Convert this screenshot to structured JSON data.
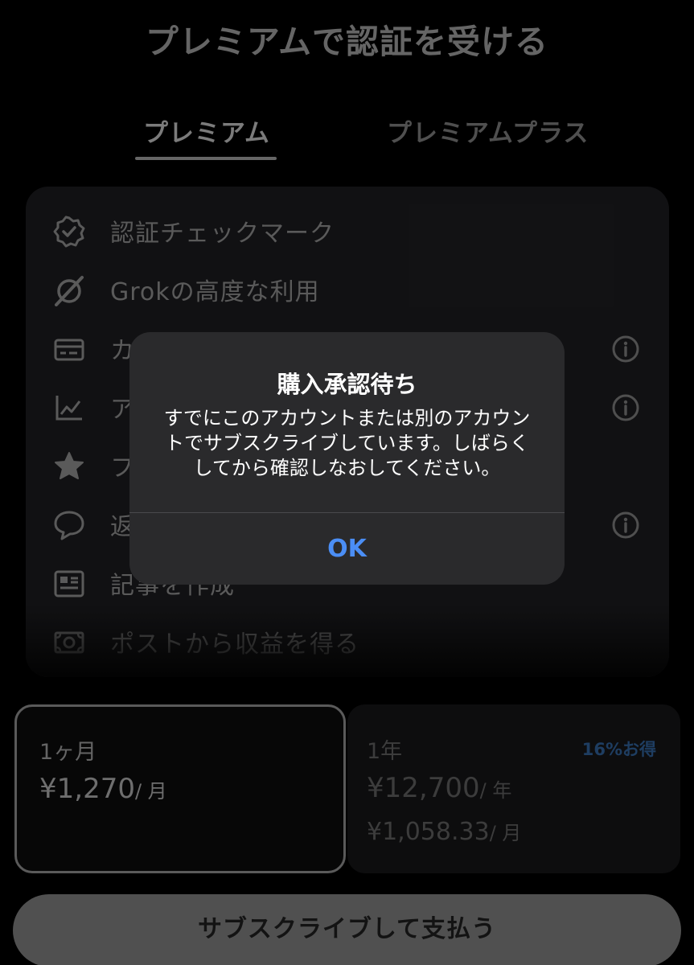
{
  "page_title": "プレミアムで認証を受ける",
  "tabs": [
    {
      "label": "プレミアム",
      "active": true
    },
    {
      "label": "プレミアムプラス",
      "active": false
    }
  ],
  "features": [
    {
      "label": "認証チェックマーク",
      "icon": "verified-badge-icon",
      "info": false
    },
    {
      "label": "Grokの高度な利用",
      "icon": "grok-icon",
      "info": false
    },
    {
      "label": "カ",
      "icon": "card-icon",
      "info": true
    },
    {
      "label": "ア",
      "icon": "analytics-icon",
      "info": true
    },
    {
      "label": "フ",
      "icon": "star-icon",
      "info": false
    },
    {
      "label": "返",
      "icon": "reply-bubble-icon",
      "info": true
    },
    {
      "label": "記事を作成",
      "icon": "article-icon",
      "info": false
    },
    {
      "label": "ポストから収益を得る",
      "icon": "money-icon",
      "info": false
    }
  ],
  "alert": {
    "title": "購入承認待ち",
    "message_lines": [
      "すでにこのアカウントまたは別のアカウン",
      "トでサブスクライブしています。しばらく",
      "してから確認しなおしてください。"
    ],
    "ok_label": "OK"
  },
  "plans": {
    "monthly": {
      "name": "1ヶ月",
      "price": "¥1,270",
      "unit": "/ 月",
      "selected": true
    },
    "yearly": {
      "name": "1年",
      "price": "¥12,700",
      "unit": "/ 年",
      "monthly_price": "¥1,058.33",
      "monthly_unit": "/ 月",
      "badge": "16%お得",
      "selected": false
    }
  },
  "subscribe_label": "サブスクライブして支払う",
  "colors": {
    "accent": "#4b8ef5",
    "badge": "#2f5f95",
    "background": "#000000",
    "card": "#1b1b1e"
  }
}
